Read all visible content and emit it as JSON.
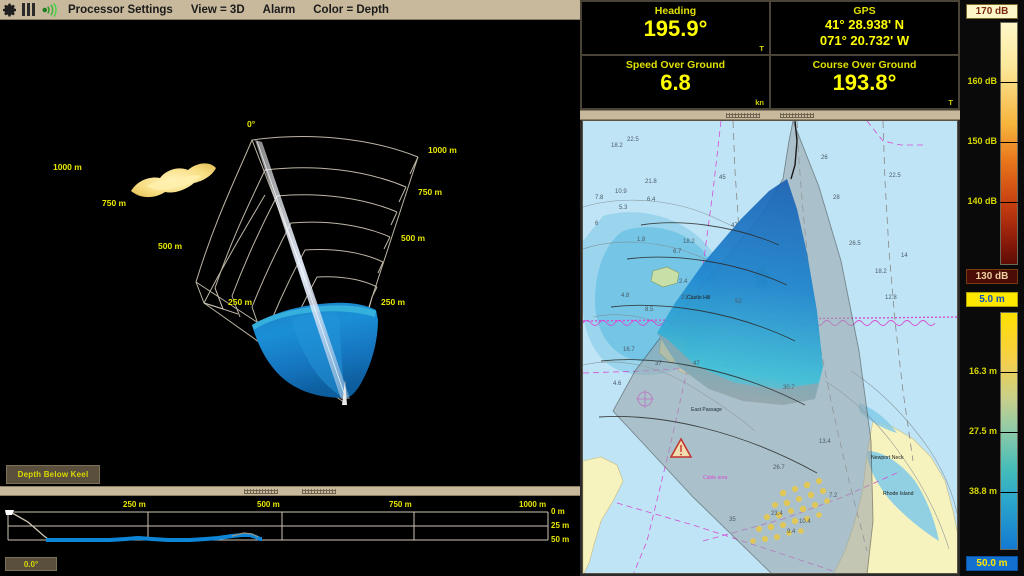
{
  "menubar": {
    "icons": [
      "gear-icon",
      "bars-icon",
      "sonar-signal-icon"
    ],
    "items": [
      {
        "label": "Processor Settings"
      },
      {
        "label": "View = 3D"
      },
      {
        "label": "Alarm"
      },
      {
        "label": "Color = Depth"
      }
    ]
  },
  "sonar3d": {
    "bearing_label": "0°",
    "left_range_labels": [
      "1000 m",
      "750 m",
      "500 m",
      "250 m"
    ],
    "right_range_labels": [
      "1000 m",
      "750 m",
      "500 m",
      "250 m"
    ]
  },
  "depth_button": {
    "label": "Depth Below Keel"
  },
  "angle_button": {
    "label": "0.0°"
  },
  "profile": {
    "x_labels": [
      "250 m",
      "500 m",
      "750 m",
      "1000 m"
    ],
    "y_labels": [
      "0 m",
      "25 m",
      "50 m"
    ]
  },
  "nav": {
    "heading": {
      "title": "Heading",
      "value": "195.9°",
      "unit": "T"
    },
    "gps": {
      "title": "GPS",
      "lat": "41° 28.938' N",
      "lon": "071° 20.732' W"
    },
    "sog": {
      "title": "Speed Over Ground",
      "value": "6.8",
      "unit": "kn"
    },
    "cog": {
      "title": "Course Over Ground",
      "value": "193.8°",
      "unit": "T"
    }
  },
  "colorbars": {
    "amplitude": {
      "top_label": "170 dB",
      "bottom_label": "130 dB",
      "ticks": [
        "160 dB",
        "150 dB",
        "140 dB"
      ],
      "top_color": "#fdf6c8",
      "bottom_color": "#5e0c06"
    },
    "depth": {
      "top_label": "5.0 m",
      "bottom_label": "50.0 m",
      "ticks": [
        "16.3 m",
        "27.5 m",
        "38.8 m"
      ],
      "top_color": "#ffe000",
      "bottom_color": "#1479d0"
    }
  },
  "chart": {
    "place_labels": [
      "Newport Neck",
      "Rhode Island",
      "East Passage",
      "Castle Hill"
    ],
    "soundings": [
      "22.5",
      "18.2",
      "21.8",
      "10.9",
      "7.8",
      "6.4",
      "5.3",
      "6",
      "1.8",
      "47",
      "45",
      "52",
      "21.3",
      "8.5",
      "4.8",
      "16.7",
      "37",
      "9.4",
      "26",
      "28",
      "26.5",
      "14",
      "12.8",
      "30.7",
      "13.4",
      "26.7",
      "35",
      "23.4",
      "10.4",
      "18.3",
      "9.4",
      "4.6"
    ],
    "sonar_cone_color": "#9aa3a8"
  },
  "colors": {
    "menubar_bg": "#c8b89c",
    "panel_bg": "#000000",
    "accent_yellow": "#ffff00",
    "label_yellow": "#e8e800",
    "chart_water": "#bfe4f5",
    "chart_land": "#f7f3bf",
    "chart_shallow": "#7fc9e8"
  }
}
